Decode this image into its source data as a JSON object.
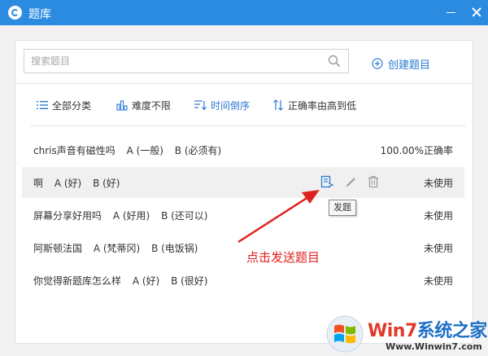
{
  "window": {
    "title": "题库"
  },
  "search": {
    "placeholder": "搜索题目",
    "create_label": "创建题目"
  },
  "filters": [
    {
      "label": "全部分类",
      "icon": "list-icon"
    },
    {
      "label": "难度不限",
      "icon": "bar-chart-icon"
    },
    {
      "label": "时间倒序",
      "icon": "sort-time-icon"
    },
    {
      "label": "正确率由高到低",
      "icon": "sort-arrows-icon"
    }
  ],
  "questions": [
    {
      "title": "chris声音有磁性吗",
      "options": [
        "A (一般)",
        "B (必须有)"
      ],
      "status": "100.00%正确率"
    },
    {
      "title": "啊",
      "options": [
        "A (好)",
        "B (好)"
      ],
      "status": "未使用"
    },
    {
      "title": "屏幕分享好用吗",
      "options": [
        "A (好用)",
        "B (还可以)"
      ],
      "status": "未使用"
    },
    {
      "title": "阿斯顿法国",
      "options": [
        "A (梵蒂冈)",
        "B (电饭锅)"
      ],
      "status": "未使用"
    },
    {
      "title": "你觉得新题库怎么样",
      "options": [
        "A (好)",
        "B (很好)"
      ],
      "status": "未使用"
    }
  ],
  "tooltip": {
    "text": "发题"
  },
  "annotation": {
    "text": "点击发送题目",
    "color": "#e02020"
  },
  "watermark": {
    "brand_red": "Win7",
    "brand_blue": "系统之家",
    "url": "Www.Winwin7.com"
  },
  "colors": {
    "titlebar": "#2a8be0",
    "accent": "#2a7ad4"
  }
}
